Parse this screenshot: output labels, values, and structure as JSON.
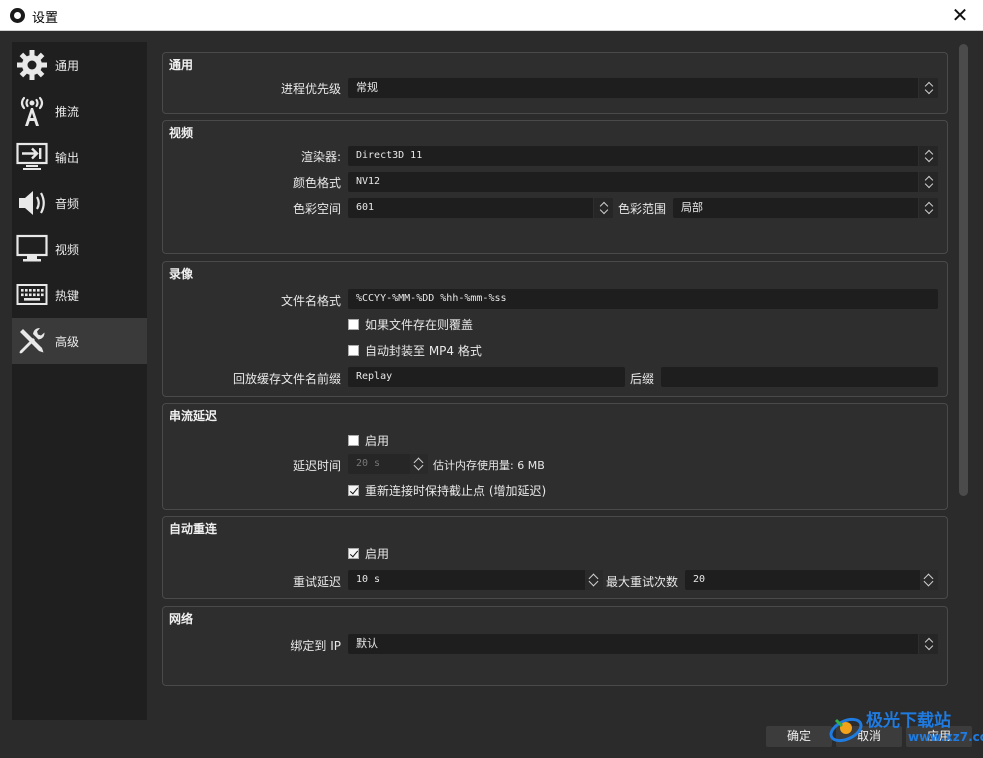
{
  "window": {
    "title": "设置",
    "close_glyph": "✕"
  },
  "sidebar": {
    "items": [
      {
        "label": "通用",
        "icon": "gear-icon"
      },
      {
        "label": "推流",
        "icon": "broadcast-tower-icon"
      },
      {
        "label": "输出",
        "icon": "output-monitor-icon"
      },
      {
        "label": "音频",
        "icon": "speaker-icon"
      },
      {
        "label": "视频",
        "icon": "monitor-icon"
      },
      {
        "label": "热键",
        "icon": "keyboard-icon"
      },
      {
        "label": "高级",
        "icon": "tools-icon",
        "active": true
      }
    ]
  },
  "general": {
    "title": "通用",
    "priority_label": "进程优先级",
    "priority_value": "常规"
  },
  "video": {
    "title": "视频",
    "renderer_label": "渲染器:",
    "renderer_value": "Direct3D 11",
    "color_format_label": "颜色格式",
    "color_format_value": "NV12",
    "color_space_label": "色彩空间",
    "color_space_value": "601",
    "color_range_label": "色彩范围",
    "color_range_value": "局部"
  },
  "recording": {
    "title": "录像",
    "filename_format_label": "文件名格式",
    "filename_format_value": "%CCYY-%MM-%DD %hh-%mm-%ss",
    "overwrite_label": "如果文件存在则覆盖",
    "overwrite_checked": false,
    "automux_label": "自动封装至 MP4 格式",
    "automux_checked": false,
    "replay_prefix_label": "回放缓存文件名前缀",
    "replay_prefix_value": "Replay",
    "suffix_label": "后缀",
    "suffix_value": ""
  },
  "stream_delay": {
    "title": "串流延迟",
    "enable_label": "启用",
    "enable_checked": false,
    "duration_label": "延迟时间",
    "duration_value": "20 s",
    "memory_estimate": "估计内存使用量: 6 MB",
    "preserve_label": "重新连接时保持截止点 (增加延迟)",
    "preserve_checked": true
  },
  "auto_reconnect": {
    "title": "自动重连",
    "enable_label": "启用",
    "enable_checked": true,
    "retry_delay_label": "重试延迟",
    "retry_delay_value": "10 s",
    "max_retries_label": "最大重试次数",
    "max_retries_value": "20"
  },
  "network": {
    "title": "网络",
    "bind_ip_label": "绑定到 IP",
    "bind_ip_value": "默认"
  },
  "footer": {
    "ok_label": "确定",
    "cancel_label": "取消",
    "apply_label": "应用"
  },
  "watermark": {
    "text": "极光下载站",
    "url": "www.xz7.com"
  },
  "colors": {
    "background": "#2b2b2b",
    "sidebar": "#1f1f1f",
    "input": "#1e1e1e",
    "watermark": "#1f7be0"
  }
}
